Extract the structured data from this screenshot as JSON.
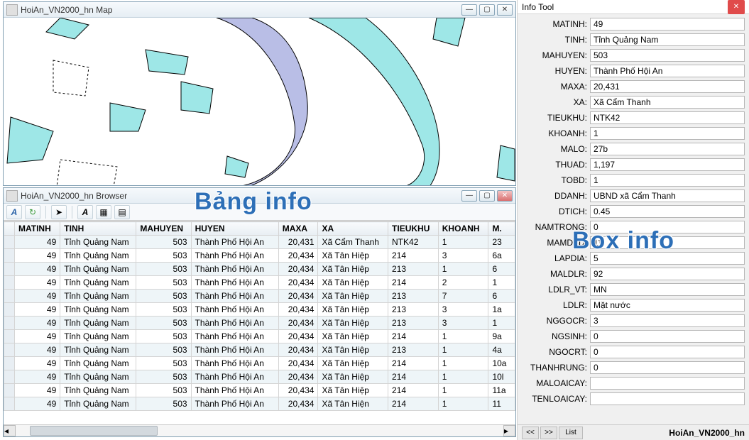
{
  "map_window": {
    "title": "HoiAn_VN2000_hn Map"
  },
  "browser_window": {
    "title": "HoiAn_VN2000_hn Browser",
    "columns": [
      "MATINH",
      "TINH",
      "MAHUYEN",
      "HUYEN",
      "MAXA",
      "XA",
      "TIEUKHU",
      "KHOANH",
      "M."
    ],
    "rows": [
      [
        "49",
        "Tỉnh Quảng Nam",
        "503",
        "Thành Phố Hội An",
        "20,431",
        "Xã Cẩm Thanh",
        "NTK42",
        "1",
        "23"
      ],
      [
        "49",
        "Tỉnh Quảng Nam",
        "503",
        "Thành Phố Hội An",
        "20,434",
        "Xã Tân Hiệp",
        "214",
        "3",
        "6a"
      ],
      [
        "49",
        "Tỉnh Quảng Nam",
        "503",
        "Thành Phố Hội An",
        "20,434",
        "Xã Tân Hiệp",
        "213",
        "1",
        "6"
      ],
      [
        "49",
        "Tỉnh Quảng Nam",
        "503",
        "Thành Phố Hội An",
        "20,434",
        "Xã Tân Hiệp",
        "214",
        "2",
        "1"
      ],
      [
        "49",
        "Tỉnh Quảng Nam",
        "503",
        "Thành Phố Hội An",
        "20,434",
        "Xã Tân Hiệp",
        "213",
        "7",
        "6"
      ],
      [
        "49",
        "Tỉnh Quảng Nam",
        "503",
        "Thành Phố Hội An",
        "20,434",
        "Xã Tân Hiệp",
        "213",
        "3",
        "1a"
      ],
      [
        "49",
        "Tỉnh Quảng Nam",
        "503",
        "Thành Phố Hội An",
        "20,434",
        "Xã Tân Hiệp",
        "213",
        "3",
        "1"
      ],
      [
        "49",
        "Tỉnh Quảng Nam",
        "503",
        "Thành Phố Hội An",
        "20,434",
        "Xã Tân Hiệp",
        "214",
        "1",
        "9a"
      ],
      [
        "49",
        "Tỉnh Quảng Nam",
        "503",
        "Thành Phố Hội An",
        "20,434",
        "Xã Tân Hiệp",
        "213",
        "1",
        "4a"
      ],
      [
        "49",
        "Tỉnh Quảng Nam",
        "503",
        "Thành Phố Hội An",
        "20,434",
        "Xã Tân Hiệp",
        "214",
        "1",
        "10a"
      ],
      [
        "49",
        "Tỉnh Quảng Nam",
        "503",
        "Thành Phố Hội An",
        "20,434",
        "Xã Tân Hiệp",
        "214",
        "1",
        "10l"
      ],
      [
        "49",
        "Tỉnh Quảng Nam",
        "503",
        "Thành Phố Hội An",
        "20,434",
        "Xã Tân Hiệp",
        "214",
        "1",
        "11a"
      ],
      [
        "49",
        "Tỉnh Quảng Nam",
        "503",
        "Thành Phố Hội An",
        "20,434",
        "Xã Tân Hiện",
        "214",
        "1",
        "11"
      ]
    ]
  },
  "info_tool": {
    "title": "Info Tool",
    "fields": [
      {
        "label": "MATINH:",
        "value": "49"
      },
      {
        "label": "TINH:",
        "value": "Tỉnh Quảng Nam"
      },
      {
        "label": "MAHUYEN:",
        "value": "503"
      },
      {
        "label": "HUYEN:",
        "value": "Thành Phố Hội An"
      },
      {
        "label": "MAXA:",
        "value": "20,431"
      },
      {
        "label": "XA:",
        "value": "Xã Cẩm Thanh"
      },
      {
        "label": "TIEUKHU:",
        "value": "NTK42"
      },
      {
        "label": "KHOANH:",
        "value": "1"
      },
      {
        "label": "MALO:",
        "value": "27b"
      },
      {
        "label": "THUAD:",
        "value": "1,197"
      },
      {
        "label": "TOBD:",
        "value": "1"
      },
      {
        "label": "DDANH:",
        "value": "UBND xã  Cẩm Thanh"
      },
      {
        "label": "DTICH:",
        "value": "0.45"
      },
      {
        "label": "NAMTRONG:",
        "value": "0"
      },
      {
        "label": "MAMDSD:",
        "value": "11"
      },
      {
        "label": "LAPDIA:",
        "value": "5"
      },
      {
        "label": "MALDLR:",
        "value": "92"
      },
      {
        "label": "LDLR_VT:",
        "value": "MN"
      },
      {
        "label": "LDLR:",
        "value": "Mặt nước"
      },
      {
        "label": "NGGOCR:",
        "value": "3"
      },
      {
        "label": "NGSINH:",
        "value": "0"
      },
      {
        "label": "NGOCRT:",
        "value": "0"
      },
      {
        "label": "THANHRUNG:",
        "value": "0"
      },
      {
        "label": "MALOAICAY:",
        "value": ""
      },
      {
        "label": "TENLOAICAY:",
        "value": ""
      }
    ],
    "footer_btns": {
      "prev": "<<",
      "next": ">>",
      "list": "List"
    },
    "status": "HoiAn_VN2000_hn"
  },
  "overlays": {
    "bang": "Bảng info",
    "box": "Box info"
  },
  "colors": {
    "cyan": "#9ee7e7",
    "lav": "#b9bee6",
    "outline": "#000"
  }
}
